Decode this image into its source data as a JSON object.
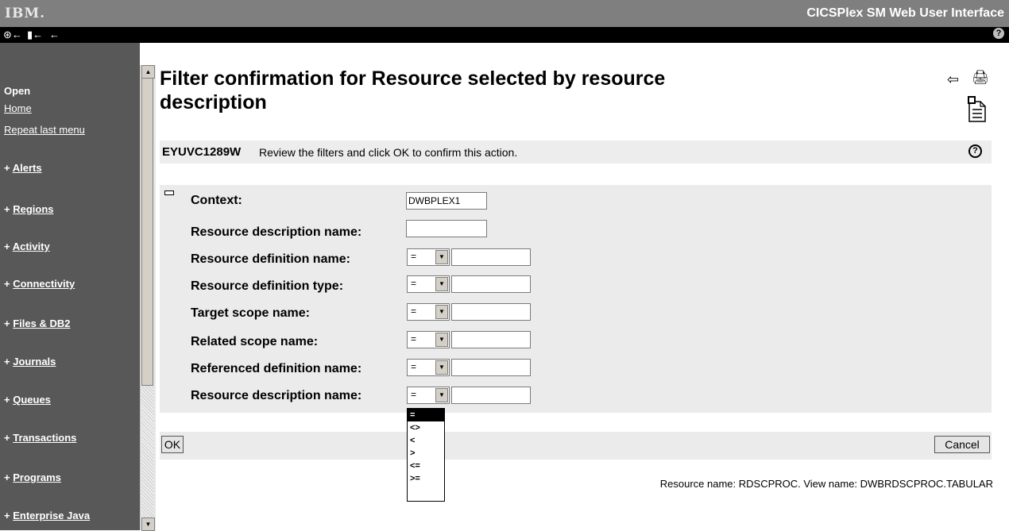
{
  "banner": {
    "logo": "IBM.",
    "app_title": "CICSPlex SM Web User Interface"
  },
  "toolbar": {
    "icon1": "⊛←",
    "icon2": "▮←",
    "icon3": "←",
    "help": "?"
  },
  "nav": {
    "open_label": "Open",
    "home": "Home",
    "repeat_last_menu": "Repeat last menu",
    "categories": [
      {
        "prefix": "+ ",
        "label": "Alerts"
      },
      {
        "prefix": "+ ",
        "label": "Regions"
      },
      {
        "prefix": "+ ",
        "label": "Activity"
      },
      {
        "prefix": "+ ",
        "label": "Connectivity"
      },
      {
        "prefix": "+ ",
        "label": "Files & DB2"
      },
      {
        "prefix": "+ ",
        "label": "Journals"
      },
      {
        "prefix": "+ ",
        "label": "Queues"
      },
      {
        "prefix": "+ ",
        "label": "Transactions"
      },
      {
        "prefix": "+ ",
        "label": "Programs"
      },
      {
        "prefix": "+ ",
        "label": "Enterprise Java"
      }
    ]
  },
  "page": {
    "title": "Filter confirmation for Resource selected by resource description",
    "message_code": "EYUVC1289W",
    "message_text": "Review the filters and click OK to confirm this action."
  },
  "filters": {
    "context_label": "Context:",
    "context_value": "DWBPLEX1",
    "resdesc_label": "Resource description name:",
    "resdesc_value": "",
    "rows": [
      {
        "label": "Resource definition name:",
        "operator": "=",
        "value": ""
      },
      {
        "label": "Resource definition type:",
        "operator": "=",
        "value": ""
      },
      {
        "label": "Target scope name:",
        "operator": "=",
        "value": ""
      },
      {
        "label": "Related scope name:",
        "operator": "=",
        "value": ""
      },
      {
        "label": "Referenced definition name:",
        "operator": "=",
        "value": ""
      },
      {
        "label": "Resource description name:",
        "operator": "=",
        "value": ""
      }
    ],
    "operator_options": [
      "=",
      "<>",
      "<",
      ">",
      "<=",
      ">="
    ],
    "selected_operator": "="
  },
  "buttons": {
    "ok": "OK",
    "cancel": "Cancel"
  },
  "footer": "Resource name: RDSCPROC. View name: DWBRDSCPROC.TABULAR",
  "icons": {
    "back": "back-arrow-icon",
    "print": "print-icon",
    "doc": "document-list-icon",
    "help": "help-icon"
  },
  "colors": {
    "banner": "#7f7f7f",
    "nav": "#585858",
    "panel": "#ebebeb"
  }
}
